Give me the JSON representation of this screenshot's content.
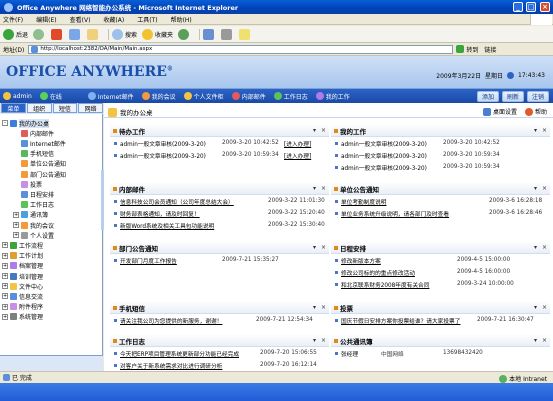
{
  "window": {
    "title": "Office Anywhere 网络智能办公系统 - Microsoft Internet Explorer",
    "btn_min": "_",
    "btn_max": "□",
    "btn_close": "×"
  },
  "menu": [
    "文件(F)",
    "编辑(E)",
    "查看(V)",
    "收藏(A)",
    "工具(T)",
    "帮助(H)"
  ],
  "toolbar": {
    "back": "后退",
    "search": "搜索",
    "favorites": "收藏夹"
  },
  "address": {
    "label": "地址(D)",
    "url": "http://localhost:2382/OA/Main/Main.aspx",
    "go": "转到",
    "links": "链接"
  },
  "header": {
    "logo": "OFFICE ANYWHERE",
    "logo_reg": "®",
    "date": "2009年3月22日",
    "weekday": "星期日",
    "time": "17:43:43"
  },
  "nav": {
    "user": "admin",
    "online": "在线",
    "items": [
      "Internet邮件",
      "我的会议",
      "个人文件柜",
      "内部邮件",
      "工作日志",
      "我的工作"
    ],
    "buttons": [
      "添加",
      "刷新",
      "注销"
    ]
  },
  "left": {
    "tabs": [
      "菜单",
      "组织",
      "短信",
      "网络"
    ],
    "tree": [
      {
        "label": "我的办公桌",
        "pm": "-",
        "indent": 0
      },
      {
        "label": "内部邮件",
        "pm": "",
        "indent": 1
      },
      {
        "label": "Internet邮件",
        "pm": "",
        "indent": 1
      },
      {
        "label": "手机短信",
        "pm": "",
        "indent": 1
      },
      {
        "label": "单位公告通知",
        "pm": "",
        "indent": 1
      },
      {
        "label": "部门公告通知",
        "pm": "",
        "indent": 1
      },
      {
        "label": "投票",
        "pm": "",
        "indent": 1
      },
      {
        "label": "日程安排",
        "pm": "",
        "indent": 1
      },
      {
        "label": "工作日志",
        "pm": "",
        "indent": 1
      },
      {
        "label": "通讯簿",
        "pm": "+",
        "indent": 1
      },
      {
        "label": "我的会议",
        "pm": "+",
        "indent": 1
      },
      {
        "label": "个人设置",
        "pm": "+",
        "indent": 1
      },
      {
        "label": "工作流程",
        "pm": "+",
        "indent": 0
      },
      {
        "label": "工作计划",
        "pm": "+",
        "indent": 0
      },
      {
        "label": "档案管理",
        "pm": "+",
        "indent": 0
      },
      {
        "label": "培训管理",
        "pm": "+",
        "indent": 0
      },
      {
        "label": "文件中心",
        "pm": "+",
        "indent": 0
      },
      {
        "label": "信息交流",
        "pm": "+",
        "indent": 0
      },
      {
        "label": "附件程序",
        "pm": "+",
        "indent": 0
      },
      {
        "label": "系统管理",
        "pm": "+",
        "indent": 0
      }
    ]
  },
  "main": {
    "title": "我的办公桌",
    "link_settings": "桌面设置",
    "link_help": "帮助",
    "panels": {
      "todo": {
        "title": "待办工作",
        "rows": [
          {
            "text": "admin一般文章审核(2009-3-20)",
            "date": "2009-3-20 10:42:52",
            "action": "[进入办理]"
          },
          {
            "text": "admin一般文章审核(2009-3-20)",
            "date": "2009-3-20 10:59:34",
            "action": "[进入办理]"
          }
        ]
      },
      "mywork": {
        "title": "我的工作",
        "rows": [
          {
            "text": "admin一般文章审核(2009-3-20)",
            "date": "2009-3-20 10:42:52"
          },
          {
            "text": "admin一般文章审核(2009-3-20)",
            "date": "2009-3-20 10:59:34"
          },
          {
            "text": "admin一般文章审核(2009-3-20)",
            "date": "2009-3-20 10:59:34"
          }
        ]
      },
      "mail": {
        "title": "内部邮件",
        "rows": [
          {
            "text": "信息科技公司会员通知（公司年度总结大会）",
            "date": "2009-3-22 11:01:30"
          },
          {
            "text": "财务部表格通知，请及时回复！",
            "date": "2009-3-22 15:20:40"
          },
          {
            "text": "新版Word系统及相关工具包功能说明",
            "date": "2009-3-22 15:30:40"
          }
        ]
      },
      "unitnotice": {
        "title": "单位公告通知",
        "rows": [
          {
            "text": "单位考勤制度说明",
            "date": "2009-3-6 16:28:18"
          },
          {
            "text": "单位业务系统升级说明，请各部门及时查看",
            "date": "2009-3-6 16:28:46"
          }
        ]
      },
      "deptnotice": {
        "title": "部门公告通知",
        "rows": [
          {
            "text": "开发部门月度工作报告",
            "date": "2009-7-21 15:35:27"
          }
        ]
      },
      "schedule": {
        "title": "日程安排",
        "rows": [
          {
            "text": "修改新版本方案",
            "date": "2009-4-5 15:00:00"
          },
          {
            "text": "修改公司标的的重点修改活动",
            "date": "2009-4-5 16:00:00"
          },
          {
            "text": "和北京联系财务2008年度有关合同",
            "date": "2009-3-24 10:00:00"
          }
        ]
      },
      "sms": {
        "title": "手机短信",
        "rows": [
          {
            "text": "请关注我公司为您提供的新服务，谢谢！",
            "date": "2009-7-21 12:54:34"
          }
        ]
      },
      "vote": {
        "title": "投票",
        "rows": [
          {
            "text": "国庆节假日安排方案你投票给谁？请大家投票了",
            "date": "2009-7-21 16:30:47"
          }
        ]
      },
      "worklog": {
        "title": "工作日志",
        "rows": [
          {
            "text": "今天把ERP项目管理系统更新部分功能已经完成",
            "date": "2009-7-20 15:06:55"
          },
          {
            "text": "对客户关于新系统需求对比进行调研分析",
            "date": "2009-7-20 16:12:14"
          }
        ]
      },
      "contacts": {
        "title": "公共通讯簿",
        "rows": [
          {
            "text": "张经理",
            "date": "中国网络",
            "extra": "13698432420"
          }
        ]
      }
    }
  },
  "status": {
    "left": "已 完成",
    "zone": "本地 Intranet"
  },
  "colors": {
    "accent": "#1b4aa6",
    "panel_bullet": "#e08a16"
  }
}
